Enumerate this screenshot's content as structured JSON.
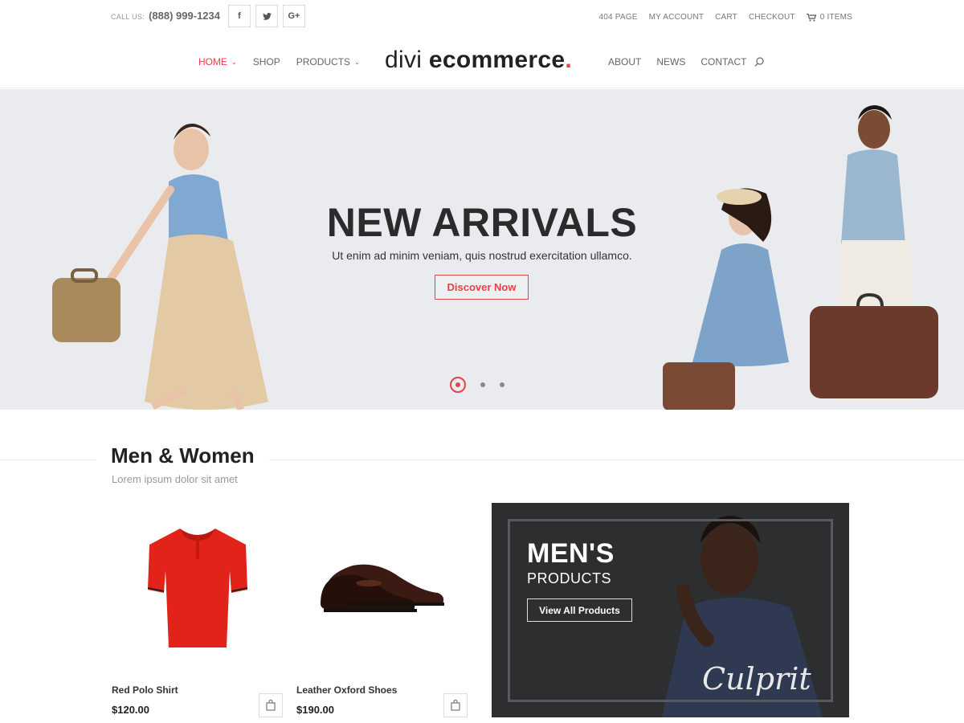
{
  "topbar": {
    "call_label": "CALL US:",
    "call_number": "(888) 999-1234",
    "social": [
      {
        "icon": "facebook-icon",
        "glyph": "f"
      },
      {
        "icon": "twitter-icon",
        "glyph": "t"
      },
      {
        "icon": "google-plus-icon",
        "glyph": "G+"
      }
    ],
    "links": [
      "404 PAGE",
      "MY ACCOUNT",
      "CART",
      "CHECKOUT"
    ],
    "cart_count": "0 ITEMS"
  },
  "nav": {
    "left": [
      {
        "label": "HOME",
        "active": true,
        "dropdown": true
      },
      {
        "label": "SHOP",
        "active": false,
        "dropdown": false
      },
      {
        "label": "PRODUCTS",
        "active": false,
        "dropdown": true
      }
    ],
    "logo": {
      "light": "divi",
      "bold": "ecommerce",
      "dot": "."
    },
    "right": [
      "ABOUT",
      "NEWS",
      "CONTACT"
    ],
    "search_icon": "search-icon"
  },
  "hero": {
    "title": "NEW ARRIVALS",
    "subtitle": "Ut enim ad minim veniam, quis nostrud exercitation ullamco.",
    "button": "Discover Now",
    "slides": 3,
    "active_slide": 1
  },
  "section": {
    "title": "Men & Women",
    "subtitle": "Lorem ipsum dolor sit amet"
  },
  "products": [
    {
      "name": "Red Polo Shirt",
      "price": "$120.00",
      "icon": "shopping-bag-icon"
    },
    {
      "name": "Leather Oxford Shoes",
      "price": "$190.00",
      "icon": "shopping-bag-icon"
    }
  ],
  "promo": {
    "title": "MEN'S",
    "subtitle": "PRODUCTS",
    "button": "View All Products",
    "shirt_text": "Culprit"
  },
  "colors": {
    "accent": "#e8404a",
    "hero_bg": "#e9ebee",
    "promo_bg": "#2d2e30"
  }
}
